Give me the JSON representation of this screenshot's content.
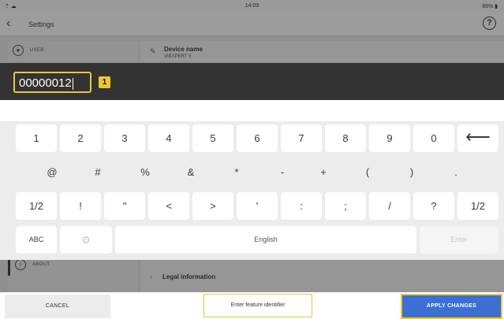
{
  "status_bar": {
    "left": "⇡ ☁",
    "time": "14:09",
    "right": "88% ▮"
  },
  "nav": {
    "back": "‹",
    "title": "Settings",
    "help": "?"
  },
  "left_panel": {
    "user": {
      "icon": "user-icon",
      "label": "USER"
    },
    "about": {
      "icon": "info-icon",
      "label": "ABOUT"
    }
  },
  "right_panel": {
    "device": {
      "label": "Device name",
      "value": "VIBXPERT II"
    },
    "legal": {
      "label": "Legal information"
    }
  },
  "input": {
    "value": "00000012",
    "badge": "1"
  },
  "keyboard": {
    "row1": [
      "1",
      "2",
      "3",
      "4",
      "5",
      "6",
      "7",
      "8",
      "9",
      "0",
      "⟵"
    ],
    "row2": [
      "@",
      "#",
      "%",
      "&",
      "*",
      "-",
      "+",
      "(",
      ")",
      "."
    ],
    "row3": [
      "1/2",
      "!",
      "\"",
      "<",
      ">",
      "'",
      ":",
      ";",
      "/",
      "?",
      "1/2"
    ],
    "row4": {
      "abc": "ABC",
      "settings_icon": "gear-icon",
      "space": "English",
      "enter": "Enter"
    }
  },
  "bottom": {
    "cancel": "CANCEL",
    "hint": "Enter feature identifier",
    "apply": "APPLY CHANGES"
  },
  "colors": {
    "accent_yellow": "#e9c53d",
    "apply_blue": "#3b6fd4",
    "input_bg": "#333333"
  }
}
